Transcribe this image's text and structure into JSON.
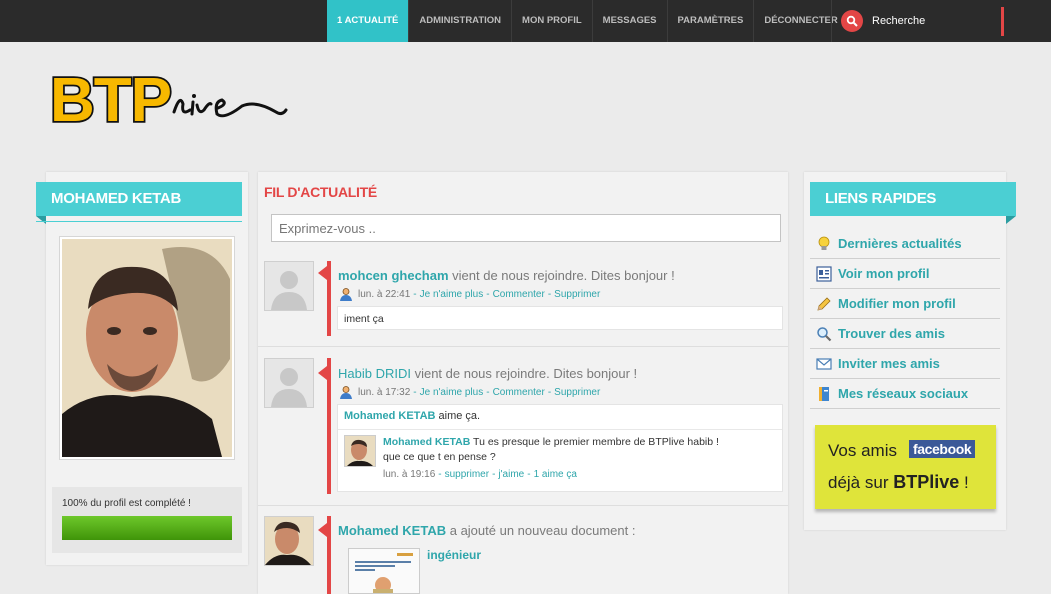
{
  "nav": {
    "items": [
      {
        "label": "1 ACTUALITÉ",
        "active": true
      },
      {
        "label": "ADMINISTRATION",
        "active": false
      },
      {
        "label": "MON PROFIL",
        "active": false
      },
      {
        "label": "MESSAGES",
        "active": false
      },
      {
        "label": "PARAMÈTRES",
        "active": false
      },
      {
        "label": "DÉCONNECTER",
        "active": false
      }
    ],
    "search_label": "Recherche"
  },
  "logo": {
    "text": "BTP",
    "script": "live"
  },
  "left": {
    "title": "MOHAMED KETAB",
    "profile_status": "100% du profil est complété !",
    "profile_progress": 1.0
  },
  "feed": {
    "title": "FIL D'ACTUALITÉ",
    "input_placeholder": "Exprimez-vous ..",
    "posts": [
      {
        "author": "mohcen ghecham",
        "action": " vient de nous rejoindre. Dites bonjour !",
        "time": "lun. à 22:41",
        "links": [
          "Je n'aime plus",
          "Commenter",
          "Supprimer"
        ],
        "comment": "iment ça"
      },
      {
        "author": "Habib DRIDI",
        "action": " vient de nous rejoindre. Dites bonjour !",
        "time": "lun. à 17:32",
        "links": [
          "Je n'aime plus",
          "Commenter",
          "Supprimer"
        ],
        "like_user": "Mohamed KETAB",
        "like_text": " aime ça.",
        "reply": {
          "author": "Mohamed KETAB",
          "text_line1": " Tu es presque le premier membre de BTPlive habib !",
          "text_line2": "que ce que t en pense ?",
          "time": "lun. à 19:16",
          "links": [
            "supprimer",
            "j'aime",
            "1 aime ça"
          ]
        }
      },
      {
        "author": "Mohamed KETAB",
        "action": " a ajouté un nouveau document :",
        "doc_title": "ingénieur"
      }
    ]
  },
  "right": {
    "title": "LIENS RAPIDES",
    "links": [
      {
        "label": "Dernières actualités",
        "icon": "lightbulb-icon"
      },
      {
        "label": "Voir mon profil",
        "icon": "profile-card-icon"
      },
      {
        "label": "Modifier mon profil",
        "icon": "pencil-icon"
      },
      {
        "label": "Trouver des amis",
        "icon": "magnifier-icon"
      },
      {
        "label": "Inviter mes amis",
        "icon": "envelope-icon"
      },
      {
        "label": "Mes réseaux sociaux",
        "icon": "book-icon"
      }
    ],
    "ad": {
      "line1": "Vos amis",
      "brand": "facebook",
      "line2_pre": "déjà sur ",
      "line2_bold": "BTPlive",
      "line2_post": " !"
    }
  },
  "colors": {
    "accent": "#4bcfd3",
    "red": "#e34646",
    "topbar": "#2b2b2b"
  }
}
